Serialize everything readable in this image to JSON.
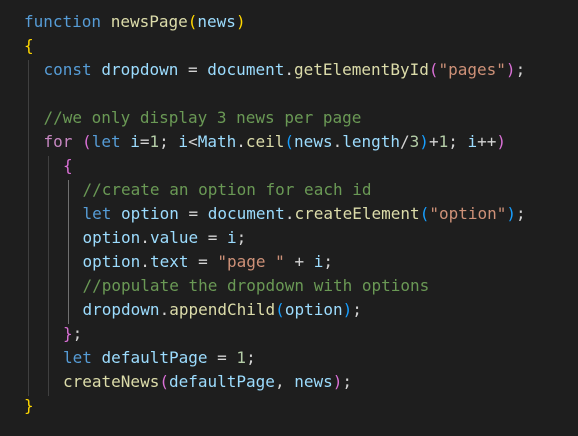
{
  "editor": {
    "theme_colors": {
      "background": "#1e1e1e",
      "keyword": "#569cd6",
      "control": "#c586c0",
      "function": "#dcdcaa",
      "variable": "#9cdcfe",
      "string": "#ce9178",
      "number": "#b5cea8",
      "comment": "#6a9955",
      "bracket_level_1": "#ffd700",
      "bracket_level_2": "#da70d6",
      "bracket_level_3": "#179fff"
    },
    "lines": [
      {
        "indent": 0,
        "tokens": [
          [
            "kw",
            "function"
          ],
          [
            "p",
            " "
          ],
          [
            "fn",
            "newsPage"
          ],
          [
            "b1",
            "("
          ],
          [
            "var",
            "news"
          ],
          [
            "b1",
            ")"
          ]
        ]
      },
      {
        "indent": 0,
        "tokens": [
          [
            "b1",
            "{"
          ]
        ]
      },
      {
        "indent": 1,
        "tokens": [
          [
            "kw",
            "const"
          ],
          [
            "p",
            " "
          ],
          [
            "var",
            "dropdown"
          ],
          [
            "p",
            " = "
          ],
          [
            "var",
            "document"
          ],
          [
            "p",
            "."
          ],
          [
            "fn",
            "getElementById"
          ],
          [
            "b2",
            "("
          ],
          [
            "str",
            "\"pages\""
          ],
          [
            "b2",
            ")"
          ],
          [
            "p",
            ";"
          ]
        ]
      },
      {
        "indent": 0,
        "tokens": []
      },
      {
        "indent": 1,
        "tokens": [
          [
            "cmt",
            "//we only display 3 news per page"
          ]
        ]
      },
      {
        "indent": 1,
        "tokens": [
          [
            "ctl",
            "for"
          ],
          [
            "p",
            " "
          ],
          [
            "b2",
            "("
          ],
          [
            "kw",
            "let"
          ],
          [
            "p",
            " "
          ],
          [
            "var",
            "i"
          ],
          [
            "p",
            "="
          ],
          [
            "num",
            "1"
          ],
          [
            "p",
            "; "
          ],
          [
            "var",
            "i"
          ],
          [
            "p",
            "<"
          ],
          [
            "var",
            "Math"
          ],
          [
            "p",
            "."
          ],
          [
            "fn",
            "ceil"
          ],
          [
            "b3",
            "("
          ],
          [
            "var",
            "news"
          ],
          [
            "p",
            "."
          ],
          [
            "var",
            "length"
          ],
          [
            "p",
            "/"
          ],
          [
            "num",
            "3"
          ],
          [
            "b3",
            ")"
          ],
          [
            "p",
            "+"
          ],
          [
            "num",
            "1"
          ],
          [
            "p",
            "; "
          ],
          [
            "var",
            "i"
          ],
          [
            "p",
            "++"
          ],
          [
            "b2",
            ")"
          ]
        ]
      },
      {
        "indent": 2,
        "tokens": [
          [
            "b2",
            "{"
          ]
        ]
      },
      {
        "indent": 3,
        "tokens": [
          [
            "cmt",
            "//create an option for each id"
          ]
        ]
      },
      {
        "indent": 3,
        "tokens": [
          [
            "kw",
            "let"
          ],
          [
            "p",
            " "
          ],
          [
            "var",
            "option"
          ],
          [
            "p",
            " = "
          ],
          [
            "var",
            "document"
          ],
          [
            "p",
            "."
          ],
          [
            "fn",
            "createElement"
          ],
          [
            "b3",
            "("
          ],
          [
            "str",
            "\"option\""
          ],
          [
            "b3",
            ")"
          ],
          [
            "p",
            ";"
          ]
        ]
      },
      {
        "indent": 3,
        "tokens": [
          [
            "var",
            "option"
          ],
          [
            "p",
            "."
          ],
          [
            "var",
            "value"
          ],
          [
            "p",
            " = "
          ],
          [
            "var",
            "i"
          ],
          [
            "p",
            ";"
          ]
        ]
      },
      {
        "indent": 3,
        "tokens": [
          [
            "var",
            "option"
          ],
          [
            "p",
            "."
          ],
          [
            "var",
            "text"
          ],
          [
            "p",
            " = "
          ],
          [
            "str",
            "\"page \""
          ],
          [
            "p",
            " + "
          ],
          [
            "var",
            "i"
          ],
          [
            "p",
            ";"
          ]
        ]
      },
      {
        "indent": 3,
        "tokens": [
          [
            "cmt",
            "//populate the dropdown with options"
          ]
        ]
      },
      {
        "indent": 3,
        "tokens": [
          [
            "var",
            "dropdown"
          ],
          [
            "p",
            "."
          ],
          [
            "fn",
            "appendChild"
          ],
          [
            "b3",
            "("
          ],
          [
            "var",
            "option"
          ],
          [
            "b3",
            ")"
          ],
          [
            "p",
            ";"
          ]
        ]
      },
      {
        "indent": 2,
        "tokens": [
          [
            "b2",
            "}"
          ],
          [
            "p",
            ";"
          ]
        ]
      },
      {
        "indent": 2,
        "tokens": [
          [
            "kw",
            "let"
          ],
          [
            "p",
            " "
          ],
          [
            "var",
            "defaultPage"
          ],
          [
            "p",
            " = "
          ],
          [
            "num",
            "1"
          ],
          [
            "p",
            ";"
          ]
        ]
      },
      {
        "indent": 2,
        "tokens": [
          [
            "fn",
            "createNews"
          ],
          [
            "b2",
            "("
          ],
          [
            "var",
            "defaultPage"
          ],
          [
            "p",
            ", "
          ],
          [
            "var",
            "news"
          ],
          [
            "b2",
            ")"
          ],
          [
            "p",
            ";"
          ]
        ]
      },
      {
        "indent": 0,
        "tokens": [
          [
            "b1",
            "}"
          ]
        ]
      }
    ]
  }
}
